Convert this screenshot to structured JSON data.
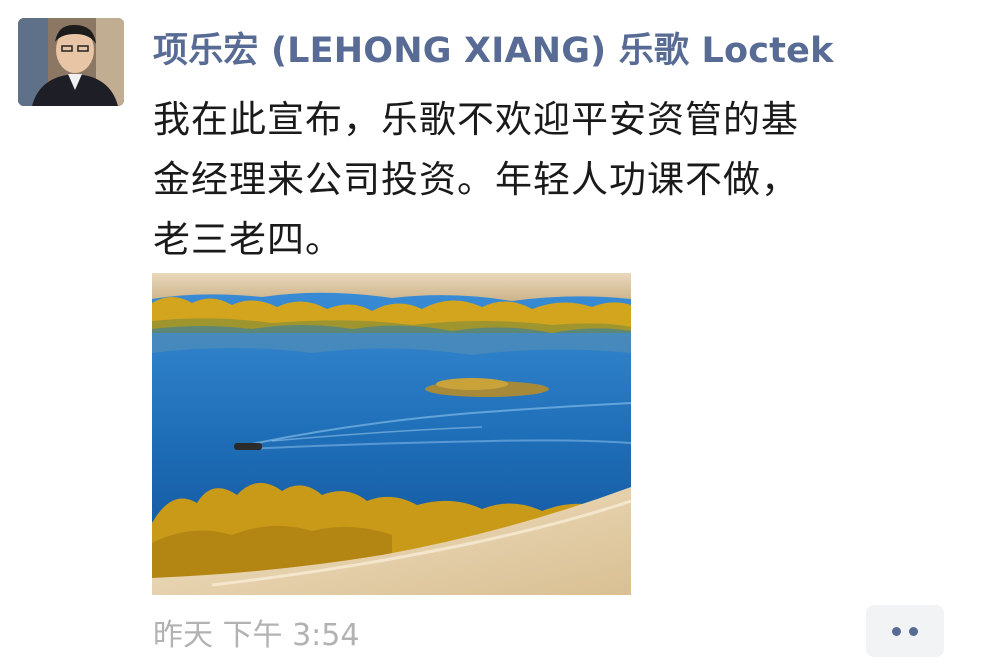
{
  "post": {
    "author": "项乐宏 (LEHONG XIANG) 乐歌 Loctek",
    "content_lines": [
      "我在此宣布，乐歌不欢迎平安资管的基",
      "金经理来公司投资。年轻人功课不做，",
      "老三老四。"
    ],
    "timestamp": "昨天 下午 3:54"
  },
  "icons": {
    "avatar": "person-portrait",
    "more": "ellipsis-comment-icon"
  },
  "colors": {
    "author_link": "#576b95",
    "timestamp": "#b2b2b2",
    "more_button_bg": "#f2f3f5",
    "lake_blue": "#1f6fb8",
    "sand": "#e6d2b0",
    "foliage": "#d9a81c"
  }
}
